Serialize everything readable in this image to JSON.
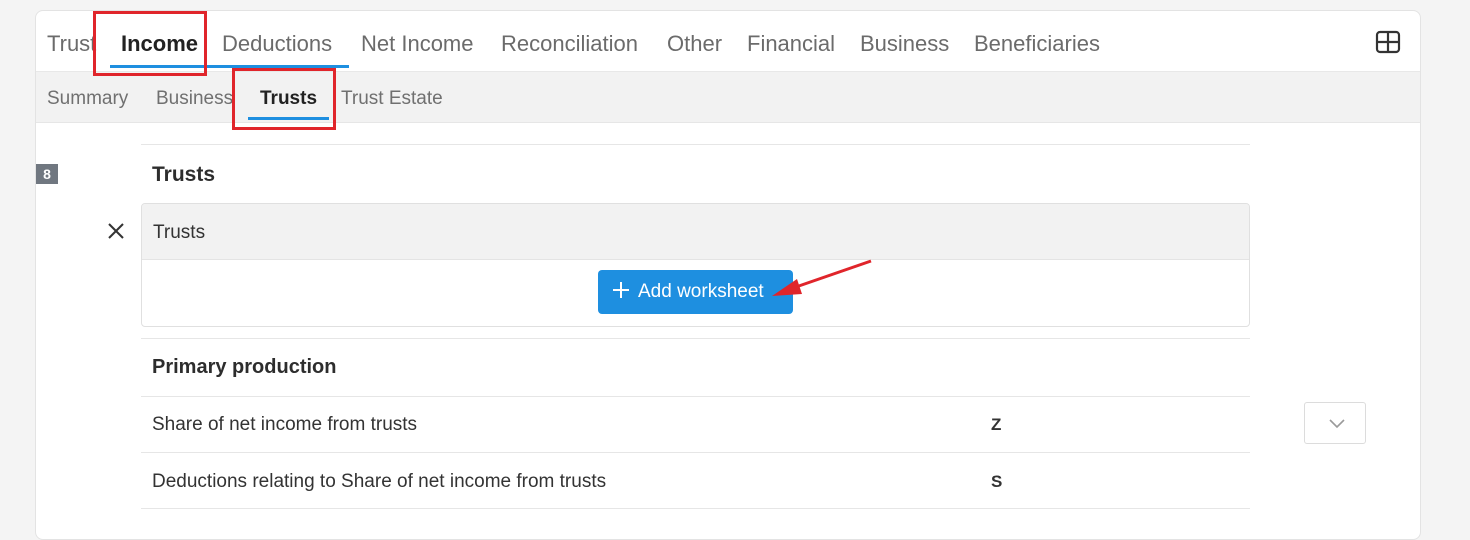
{
  "main_tabs": [
    "Trust",
    "Income",
    "Deductions",
    "Net Income",
    "Reconciliation",
    "Other",
    "Financial",
    "Business",
    "Beneficiaries"
  ],
  "main_active": "Income",
  "sub_tabs": [
    "Summary",
    "Business",
    "Trusts",
    "Trust Estate"
  ],
  "sub_active": "Trusts",
  "section_number": "8",
  "section_title": "Trusts",
  "trusts_box": {
    "label": "Trusts",
    "add_button_label": "Add worksheet"
  },
  "primary_production": {
    "title": "Primary production",
    "rows": [
      {
        "label": "Share of net income from trusts",
        "code": "Z"
      },
      {
        "label": "Deductions relating to Share of net income from trusts",
        "code": "S"
      }
    ]
  },
  "icons": {
    "grid": "grid-layout-icon",
    "close": "close-icon",
    "plus": "plus-icon",
    "dropdown": "chevron-down-icon"
  },
  "colors": {
    "accent": "#1e8fe0",
    "annotation": "#e0252b"
  }
}
